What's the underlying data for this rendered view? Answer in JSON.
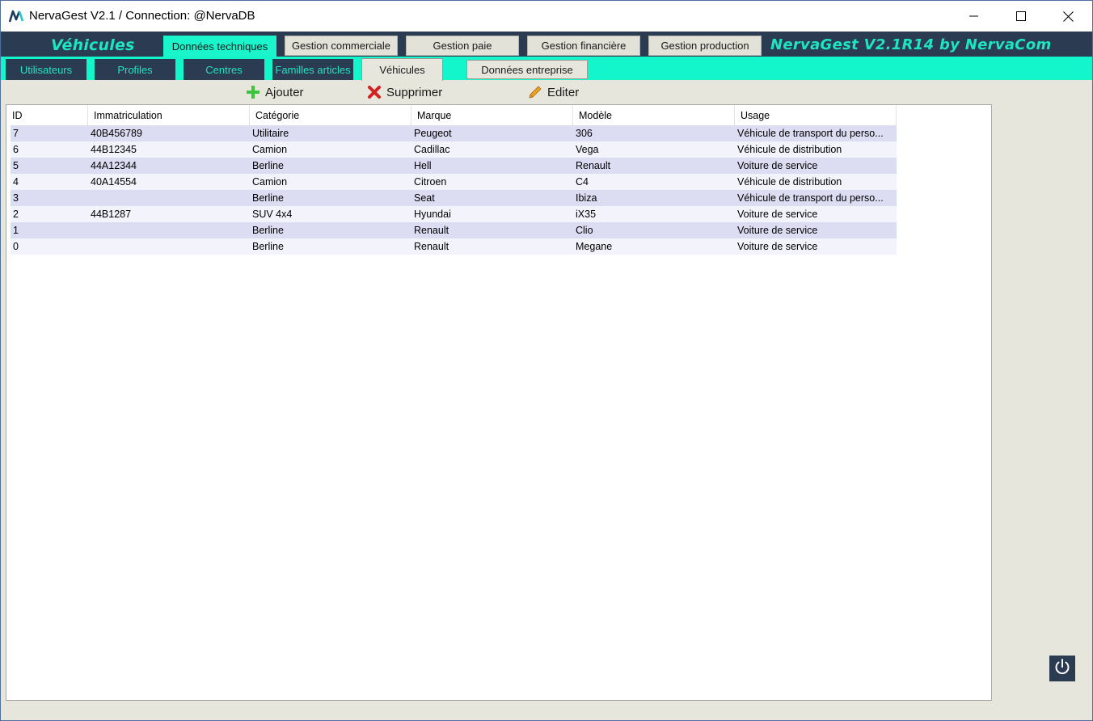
{
  "window": {
    "title": "NervaGest V2.1 / Connection: @NervaDB",
    "logo_icon": "nervagest-logo-icon",
    "controls": [
      "minimize-icon",
      "maximize-icon",
      "close-icon"
    ]
  },
  "modbar": {
    "section_title": "Véhicules",
    "brand": "NervaGest V2.1R14 by NervaCom",
    "tabs": [
      {
        "label": "Données techniques",
        "active": true
      },
      {
        "label": "Gestion commerciale",
        "active": false
      },
      {
        "label": "Gestion paie",
        "active": false
      },
      {
        "label": "Gestion financière",
        "active": false
      },
      {
        "label": "Gestion production",
        "active": false
      }
    ]
  },
  "subbar": {
    "tabs": [
      {
        "label": "Utilisateurs"
      },
      {
        "label": "Profiles"
      },
      {
        "label": "Centres"
      },
      {
        "label": "Familles articles"
      },
      {
        "label": "Véhicules",
        "active": true
      },
      {
        "label": "Données entreprise"
      }
    ]
  },
  "toolbar": {
    "add_label": "Ajouter",
    "delete_label": "Supprimer",
    "edit_label": "Editer",
    "colors": {
      "add": "#3cc43c",
      "delete": "#d42020",
      "edit": "#f0a020"
    }
  },
  "table": {
    "headers": [
      "ID",
      "Immatriculation",
      "Catégorie",
      "Marque",
      "Modèle",
      "Usage"
    ],
    "rows": [
      [
        "7",
        "40B456789",
        "Utilitaire",
        "Peugeot",
        "306",
        "Véhicule de transport du perso..."
      ],
      [
        "6",
        "44B12345",
        "Camion",
        "Cadillac",
        "Vega",
        "Véhicule de distribution"
      ],
      [
        "5",
        "44A12344",
        "Berline",
        "Hell",
        "Renault",
        "Voiture de service"
      ],
      [
        "4",
        "40A14554",
        "Camion",
        "Citroen",
        "C4",
        "Véhicule de distribution"
      ],
      [
        "3",
        "",
        "Berline",
        "Seat",
        "Ibiza",
        "Véhicule de transport du perso..."
      ],
      [
        "2",
        "44B1287",
        "SUV 4x4",
        "Hyundai",
        "iX35",
        "Voiture de service"
      ],
      [
        "1",
        "",
        "Berline",
        "Renault",
        "Clio",
        "Voiture de service"
      ],
      [
        "0",
        "",
        "Berline",
        "Renault",
        "Megane",
        "Voiture de service"
      ]
    ]
  },
  "power_icon": "power-icon",
  "colors": {
    "accent": "#1bf5cc",
    "navy": "#2b3b52",
    "row_odd": "#dcdcf2",
    "row_even": "#f3f3fb"
  }
}
